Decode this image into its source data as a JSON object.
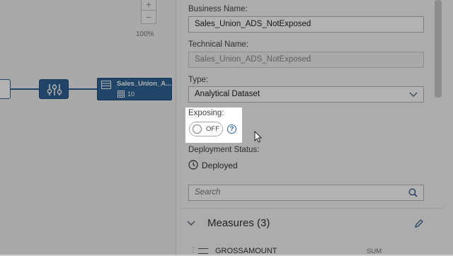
{
  "canvas": {
    "zoom_level": "100%",
    "zoom_in_icon": "+",
    "zoom_out_icon": "−",
    "node_name": "Sales_Union_A...",
    "node_count": "10"
  },
  "panel": {
    "business_name_label": "Business Name:",
    "business_name_value": "Sales_Union_ADS_NotExposed",
    "technical_name_label": "Technical Name:",
    "technical_name_value": "Sales_Union_ADS_NotExposed",
    "type_label": "Type:",
    "type_value": "Analytical Dataset",
    "exposing_label": "Exposing:",
    "exposing_value": "OFF",
    "help_icon": "?",
    "deployment_status_label": "Deployment Status:",
    "deployment_status_value": "Deployed",
    "search_placeholder": "Search",
    "measures_title": "Measures (3)",
    "measures": [
      {
        "name": "GROSSAMOUNT",
        "aggregation": "SUM"
      }
    ]
  },
  "colors": {
    "node_blue": "#2f6497",
    "panel_bg": "#f7f7f7",
    "canvas_bg": "#f3f3f3"
  }
}
